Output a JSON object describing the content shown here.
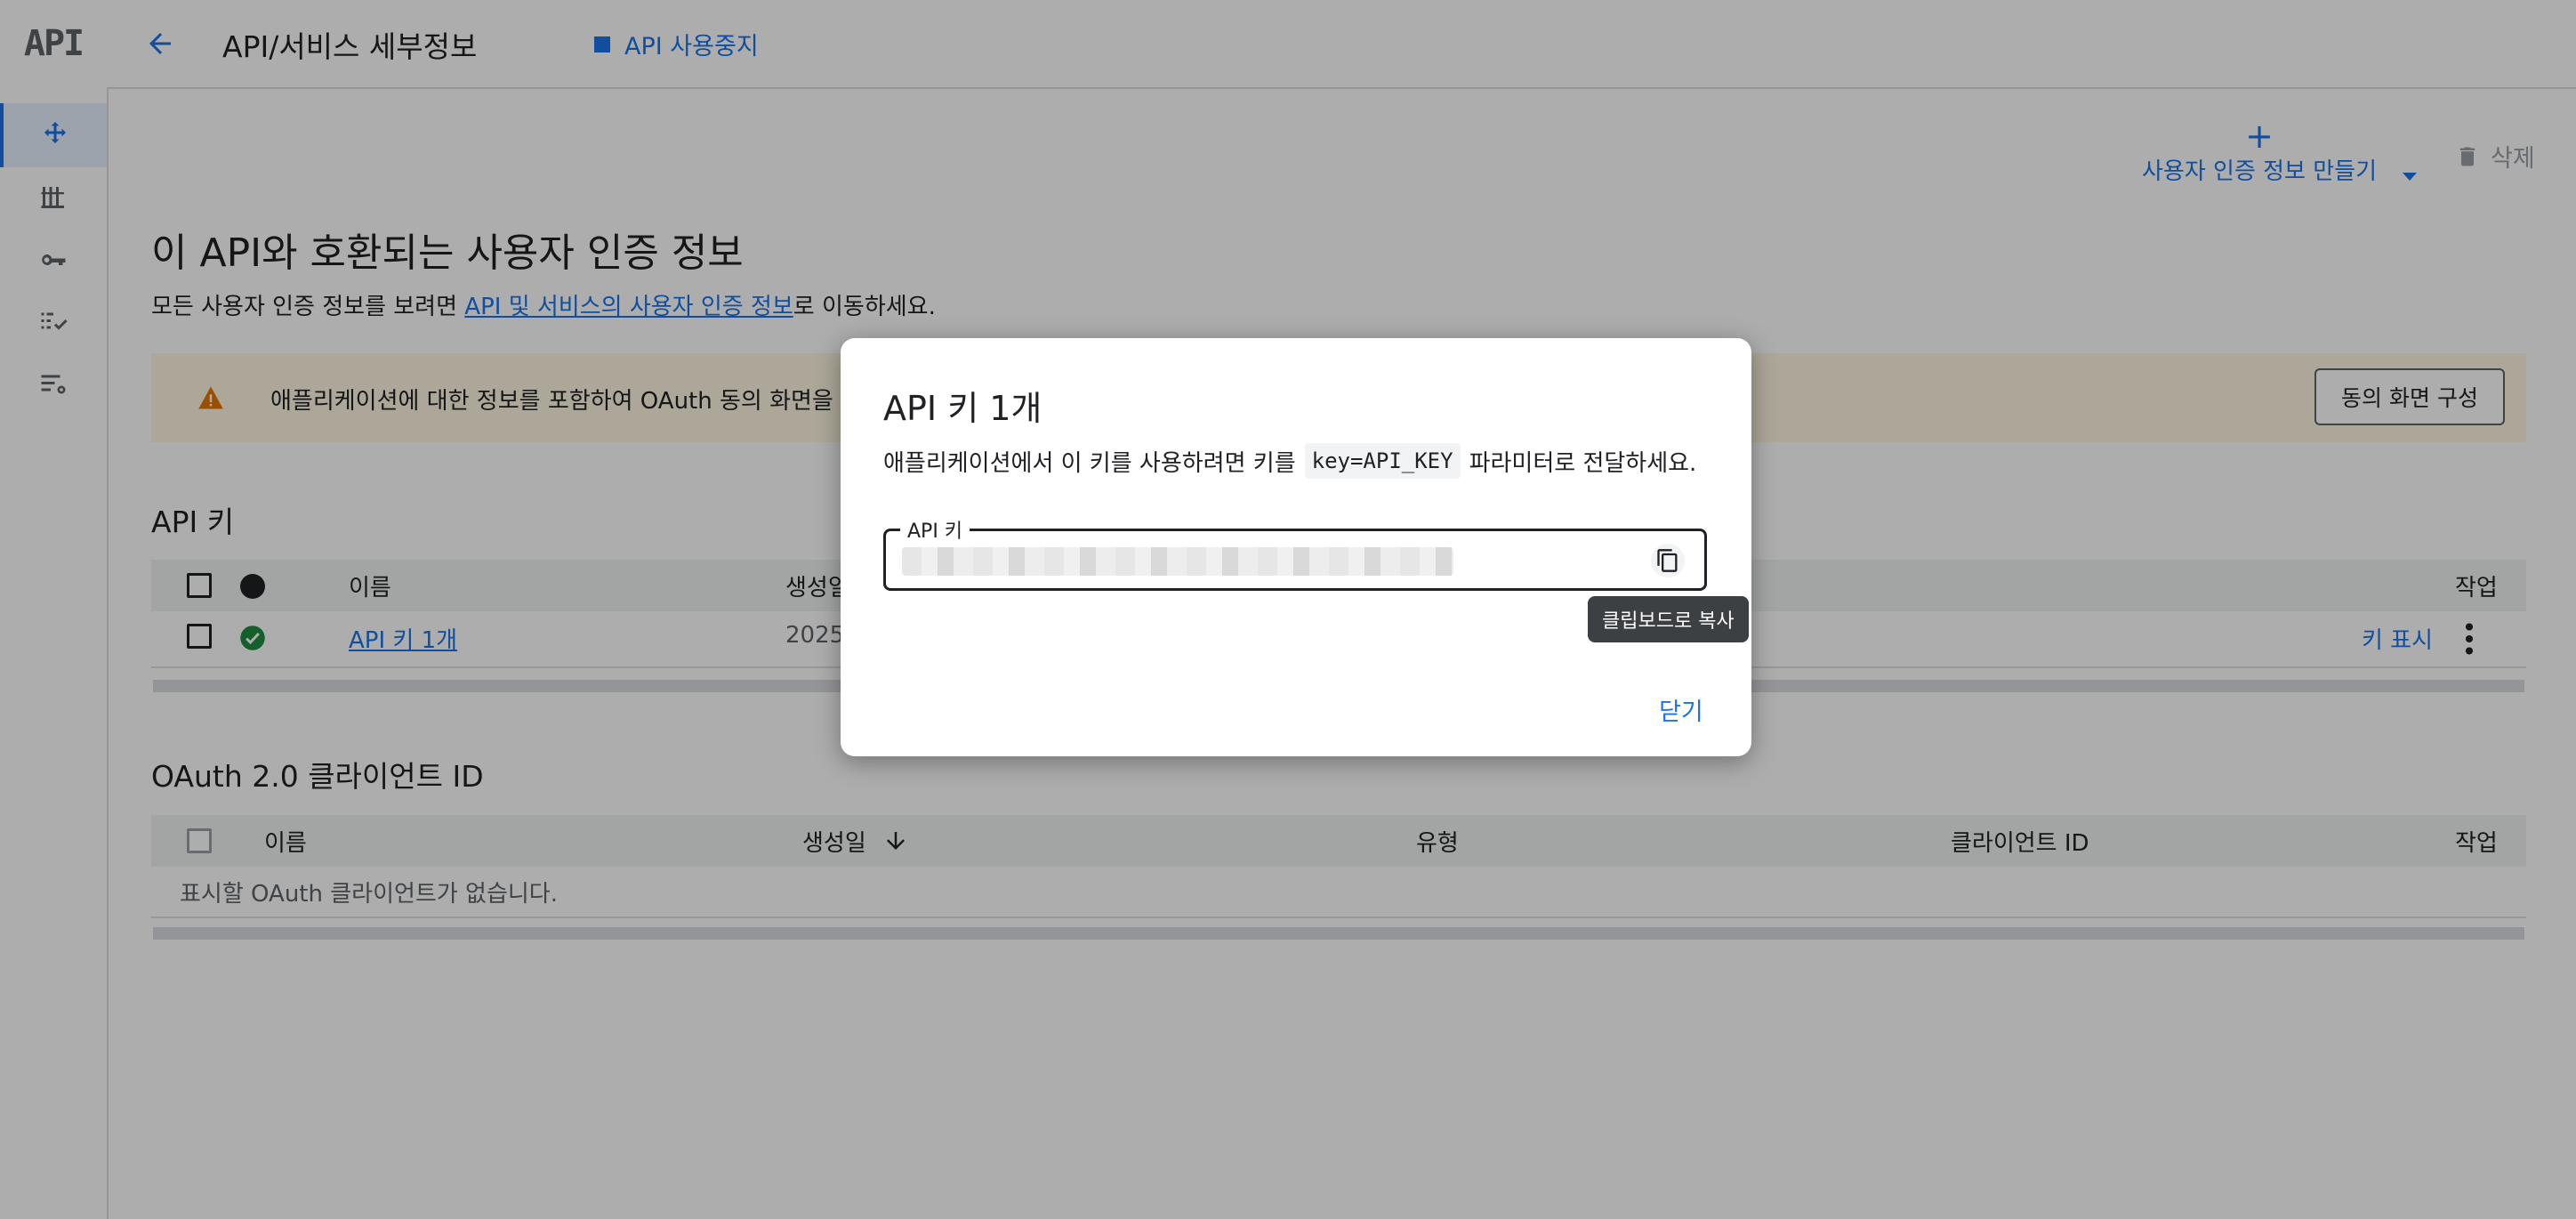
{
  "rail": {
    "logo": "API",
    "items": [
      {
        "icon": "move-icon",
        "active": true
      },
      {
        "icon": "library-icon",
        "active": false
      },
      {
        "icon": "key-icon",
        "active": false
      },
      {
        "icon": "checklist-icon",
        "active": false
      },
      {
        "icon": "settings-list-icon",
        "active": false
      }
    ]
  },
  "header": {
    "title": "API/서비스 세부정보",
    "disable_label": "API 사용중지"
  },
  "toolbar": {
    "create_label": "사용자 인증 정보 만들기",
    "delete_label": "삭제"
  },
  "main": {
    "heading": "이 API와 호환되는 사용자 인증 정보",
    "desc_prefix": "모든 사용자 인증 정보를 보려면 ",
    "desc_link": "API 및 서비스의 사용자 인증 정보",
    "desc_suffix": "로 이동하세요.",
    "warning_text": "애플리케이션에 대한 정보를 포함하여 OAuth 동의 화면을 구",
    "consent_button": "동의 화면 구성"
  },
  "api_keys": {
    "heading": "API 키",
    "columns": {
      "name": "이름",
      "created": "생성일",
      "actions": "작업"
    },
    "rows": [
      {
        "name": "API 키 1개",
        "created": "2025",
        "show_key": "키 표시"
      }
    ]
  },
  "oauth": {
    "heading": "OAuth 2.0 클라이언트 ID",
    "columns": {
      "name": "이름",
      "created": "생성일",
      "type": "유형",
      "client_id": "클라이언트 ID",
      "actions": "작업"
    },
    "empty": "표시할 OAuth 클라이언트가 없습니다."
  },
  "dialog": {
    "title": "API 키 1개",
    "desc_prefix": "애플리케이션에서 이 키를 사용하려면 키를",
    "param": "key=API_KEY",
    "desc_suffix": "파라미터로 전달하세요.",
    "field_label": "API 키",
    "copy_tooltip": "클립보드로 복사",
    "close_label": "닫기"
  },
  "colors": {
    "accent": "#1a73e8",
    "warning_bg": "#fef7e0",
    "warning_icon": "#e37400",
    "success": "#1e8e3e"
  }
}
